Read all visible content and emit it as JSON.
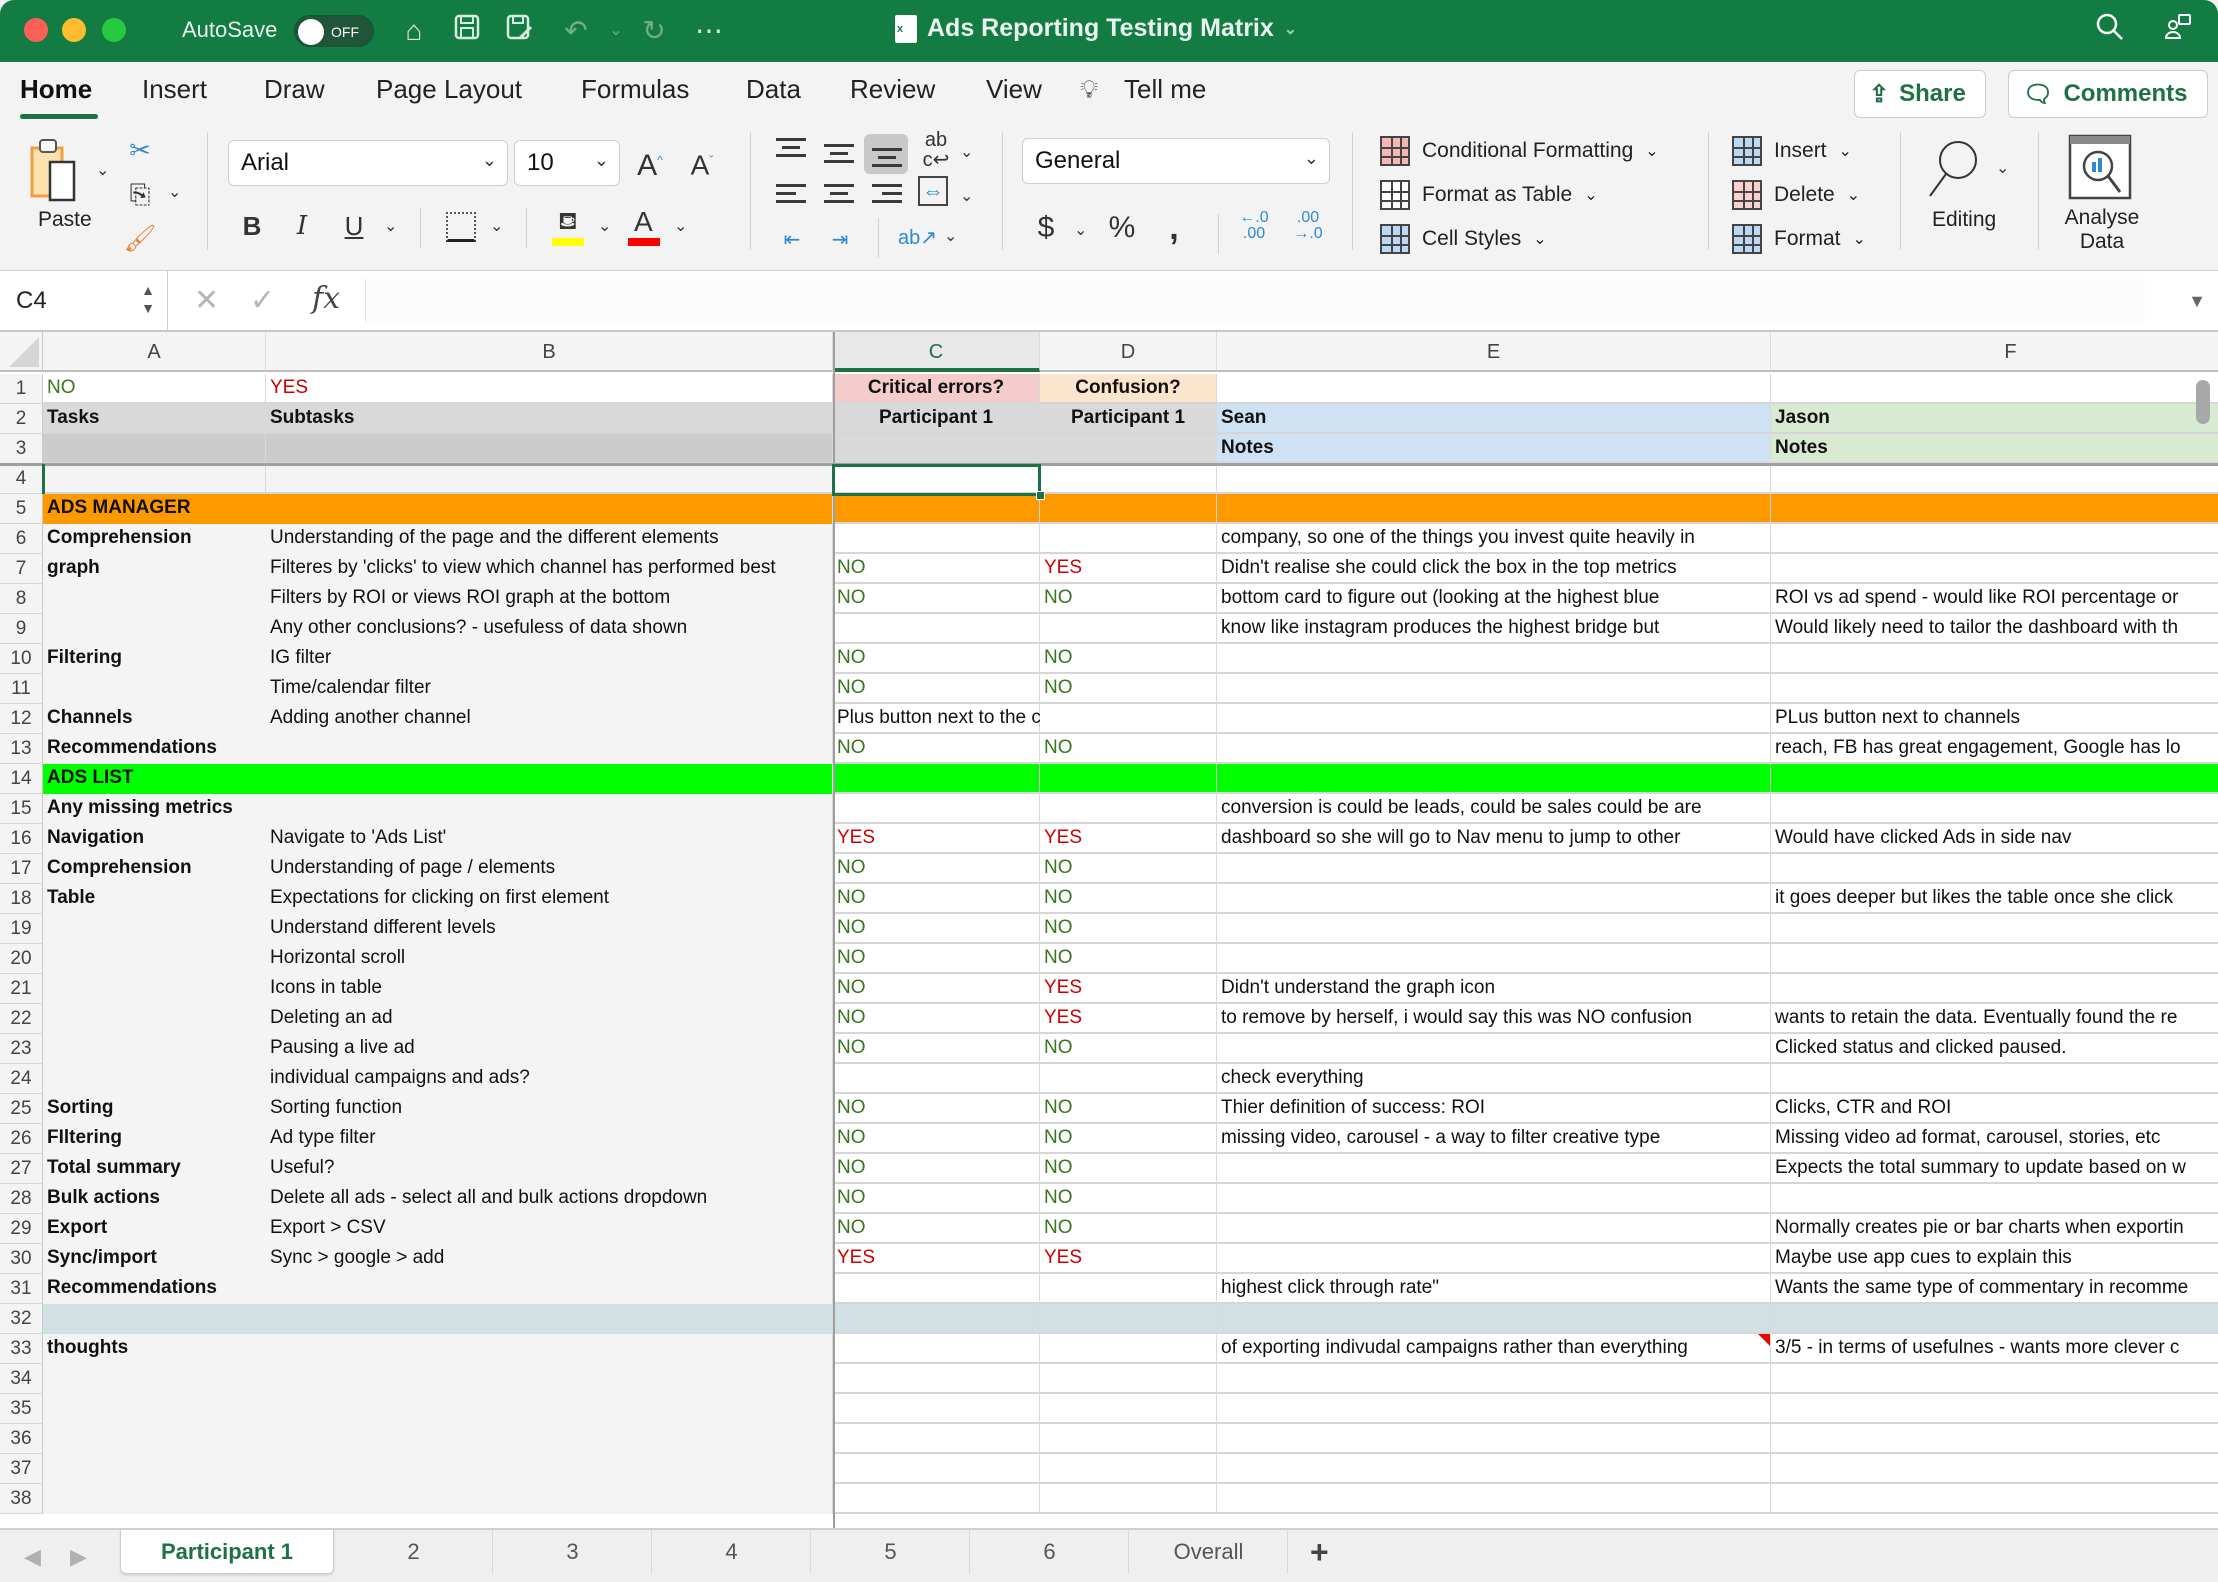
{
  "titlebar": {
    "autosave_label": "AutoSave",
    "autosave_state": "OFF",
    "document_title": "Ads Reporting Testing Matrix"
  },
  "ribbon_tabs": [
    "Home",
    "Insert",
    "Draw",
    "Page Layout",
    "Formulas",
    "Data",
    "Review",
    "View",
    "Tell me"
  ],
  "active_tab": "Home",
  "share_label": "Share",
  "comments_label": "Comments",
  "ribbon": {
    "paste_label": "Paste",
    "font_name": "Arial",
    "font_size": "10",
    "number_format": "General",
    "styles": [
      "Conditional Formatting",
      "Format as Table",
      "Cell Styles"
    ],
    "cells": [
      "Insert",
      "Delete",
      "Format"
    ],
    "editing_label": "Editing",
    "analyse_label_1": "Analyse",
    "analyse_label_2": "Data",
    "fill_color": "#ffff00",
    "font_color": "#ff0000"
  },
  "formula_bar": {
    "name_box": "C4",
    "formula": ""
  },
  "columns": [
    "A",
    "B",
    "C",
    "D",
    "E",
    "F"
  ],
  "selected_column": "C",
  "colors": {
    "no": "#38761d",
    "yes": "#cc0000",
    "ads_manager_band": "#ff9900",
    "ads_list_band": "#00ff00",
    "critical_header": "#f4cccc",
    "confusion_header": "#fce5cd",
    "sean_notes": "#cfe2f3",
    "jason_notes": "#d9ead3",
    "header_gray": "#d9d9d9",
    "row32_band": "#d0e0e3"
  },
  "rows": [
    {
      "n": "1",
      "A": "NO",
      "B": "YES",
      "C": "Critical errors?",
      "D": "Confusion?",
      "E": "",
      "F": ""
    },
    {
      "n": "2",
      "A": "Tasks",
      "B": "Subtasks",
      "C": "Participant 1",
      "D": "Participant 1",
      "E": "Sean",
      "F": "Jason"
    },
    {
      "n": "3",
      "A": "",
      "B": "",
      "C": "",
      "D": "",
      "E": "Notes",
      "F": "Notes"
    },
    {
      "n": "4",
      "A": "",
      "B": "",
      "C": "",
      "D": "",
      "E": "",
      "F": ""
    },
    {
      "n": "5",
      "A": "ADS MANAGER",
      "B": "",
      "C": "",
      "D": "",
      "E": "",
      "F": ""
    },
    {
      "n": "6",
      "A": "Comprehension",
      "B": "Understanding of the page and the different elements",
      "C": "",
      "D": "",
      "E": "company, so one of the things you invest quite heavily in",
      "F": ""
    },
    {
      "n": "7",
      "A": "graph",
      "B": "Filteres by 'clicks' to view which channel has performed best",
      "C": "NO",
      "D": "YES",
      "E": "Didn't realise she could click the box in the top metrics",
      "F": ""
    },
    {
      "n": "8",
      "A": "",
      "B": "Filters by ROI or views ROI graph at the bottom",
      "C": "NO",
      "D": "NO",
      "E": "bottom card to figure out (looking at the highest blue",
      "F": "ROI vs ad spend - would like ROI percentage or"
    },
    {
      "n": "9",
      "A": "",
      "B": "Any other conclusions? - usefuless of data shown",
      "C": "",
      "D": "",
      "E": "know like instagram produces the highest bridge but",
      "F": "Would likely need to tailor the dashboard with th"
    },
    {
      "n": "10",
      "A": "Filtering",
      "B": "IG filter",
      "C": "NO",
      "D": "NO",
      "E": "",
      "F": ""
    },
    {
      "n": "11",
      "A": "",
      "B": "Time/calendar filter",
      "C": "NO",
      "D": "NO",
      "E": "",
      "F": ""
    },
    {
      "n": "12",
      "A": "Channels",
      "B": "Adding another channel",
      "C": "Plus button next to the channel filter",
      "D": "",
      "E": "",
      "F": "PLus button next to channels"
    },
    {
      "n": "13",
      "A": "Recommendations",
      "B": "",
      "C": "NO",
      "D": "NO",
      "E": "",
      "F": "reach, FB has great engagement, Google has lo"
    },
    {
      "n": "14",
      "A": "ADS LIST",
      "B": "",
      "C": "",
      "D": "",
      "E": "",
      "F": ""
    },
    {
      "n": "15",
      "A": "Any missing metrics",
      "B": "",
      "C": "",
      "D": "",
      "E": "conversion is could be leads, could be sales could be are",
      "F": ""
    },
    {
      "n": "16",
      "A": "Navigation",
      "B": "Navigate to 'Ads List'",
      "C": "YES",
      "D": "YES",
      "E": "dashboard so she will go to Nav menu to jump to other",
      "F": "Would have clicked Ads in side nav"
    },
    {
      "n": "17",
      "A": "Comprehension",
      "B": "Understanding of page / elements",
      "C": "NO",
      "D": "NO",
      "E": "",
      "F": ""
    },
    {
      "n": "18",
      "A": "Table",
      "B": "Expectations for clicking on first element",
      "C": "NO",
      "D": "NO",
      "E": "",
      "F": "it goes deeper but likes the table once she click"
    },
    {
      "n": "19",
      "A": "",
      "B": "Understand different levels",
      "C": "NO",
      "D": "NO",
      "E": "",
      "F": ""
    },
    {
      "n": "20",
      "A": "",
      "B": "Horizontal scroll",
      "C": "NO",
      "D": "NO",
      "E": "",
      "F": ""
    },
    {
      "n": "21",
      "A": "",
      "B": "Icons in table",
      "C": "NO",
      "D": "YES",
      "E": "Didn't understand the graph icon",
      "F": ""
    },
    {
      "n": "22",
      "A": "",
      "B": "Deleting an ad",
      "C": "NO",
      "D": "YES",
      "E": "to remove by herself, i would say this was NO confusion",
      "F": "wants to retain the data. Eventually found the re"
    },
    {
      "n": "23",
      "A": "",
      "B": "Pausing a live ad",
      "C": "NO",
      "D": "NO",
      "E": "",
      "F": "Clicked status and clicked paused."
    },
    {
      "n": "24",
      "A": "",
      "B": "individual campaigns and ads?",
      "C": "",
      "D": "",
      "E": "check everything",
      "F": ""
    },
    {
      "n": "25",
      "A": "Sorting",
      "B": "Sorting function",
      "C": "NO",
      "D": "NO",
      "E": "Thier definition of success: ROI",
      "F": "Clicks, CTR and ROI"
    },
    {
      "n": "26",
      "A": "FIltering",
      "B": "Ad type filter",
      "C": "NO",
      "D": "NO",
      "E": "missing video, carousel - a way to filter creative type",
      "F": "Missing video ad format, carousel, stories, etc"
    },
    {
      "n": "27",
      "A": "Total summary",
      "B": "Useful?",
      "C": "NO",
      "D": "NO",
      "E": "",
      "F": "Expects the total summary to update based on w"
    },
    {
      "n": "28",
      "A": "Bulk actions",
      "B": "Delete all ads - select all and bulk actions dropdown",
      "C": "NO",
      "D": "NO",
      "E": "",
      "F": ""
    },
    {
      "n": "29",
      "A": "Export",
      "B": "Export > CSV",
      "C": "NO",
      "D": "NO",
      "E": "",
      "F": "Normally creates pie or bar charts when exportin"
    },
    {
      "n": "30",
      "A": "Sync/import",
      "B": "Sync > google > add",
      "C": "YES",
      "D": "YES",
      "E": "",
      "F": "Maybe use app cues to explain this"
    },
    {
      "n": "31",
      "A": "Recommendations",
      "B": "",
      "C": "",
      "D": "",
      "E": "highest click through rate\"",
      "F": "Wants the same type of commentary in recomme"
    },
    {
      "n": "32",
      "A": "",
      "B": "",
      "C": "",
      "D": "",
      "E": "",
      "F": ""
    },
    {
      "n": "33",
      "A": "thoughts",
      "B": "",
      "C": "",
      "D": "",
      "E": "of exporting indivudal campaigns rather than everything",
      "F": "3/5 - in terms of usefulnes - wants more clever c"
    },
    {
      "n": "34",
      "A": "",
      "B": "",
      "C": "",
      "D": "",
      "E": "",
      "F": ""
    },
    {
      "n": "35",
      "A": "",
      "B": "",
      "C": "",
      "D": "",
      "E": "",
      "F": ""
    },
    {
      "n": "36",
      "A": "",
      "B": "",
      "C": "",
      "D": "",
      "E": "",
      "F": ""
    },
    {
      "n": "37",
      "A": "",
      "B": "",
      "C": "",
      "D": "",
      "E": "",
      "F": ""
    },
    {
      "n": "38",
      "A": "",
      "B": "",
      "C": "",
      "D": "",
      "E": "",
      "F": ""
    }
  ],
  "sheet_tabs": [
    "Participant 1",
    "2",
    "3",
    "4",
    "5",
    "6",
    "Overall"
  ],
  "active_sheet": "Participant 1"
}
